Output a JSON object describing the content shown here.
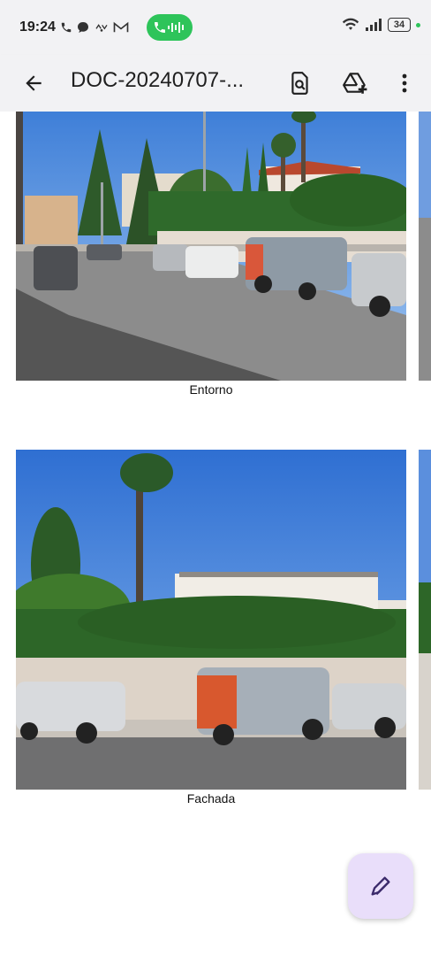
{
  "status_bar": {
    "time": "19:24",
    "battery": "34",
    "icons": [
      "phone-icon",
      "chat-icon",
      "bluetooth-icon",
      "gmail-icon",
      "wifi-icon",
      "signal-icon"
    ],
    "call_pill_color": "#2ec45a"
  },
  "app_bar": {
    "title": "DOC-20240707-...",
    "icons": [
      "back-arrow-icon",
      "document-search-icon",
      "add-to-drive-icon",
      "more-vert-icon"
    ]
  },
  "document": {
    "photos": [
      {
        "caption": "Entorno"
      },
      {
        "caption": "Fachada"
      }
    ]
  },
  "fab": {
    "icon": "edit-pen-icon",
    "color": "#e9defa"
  }
}
